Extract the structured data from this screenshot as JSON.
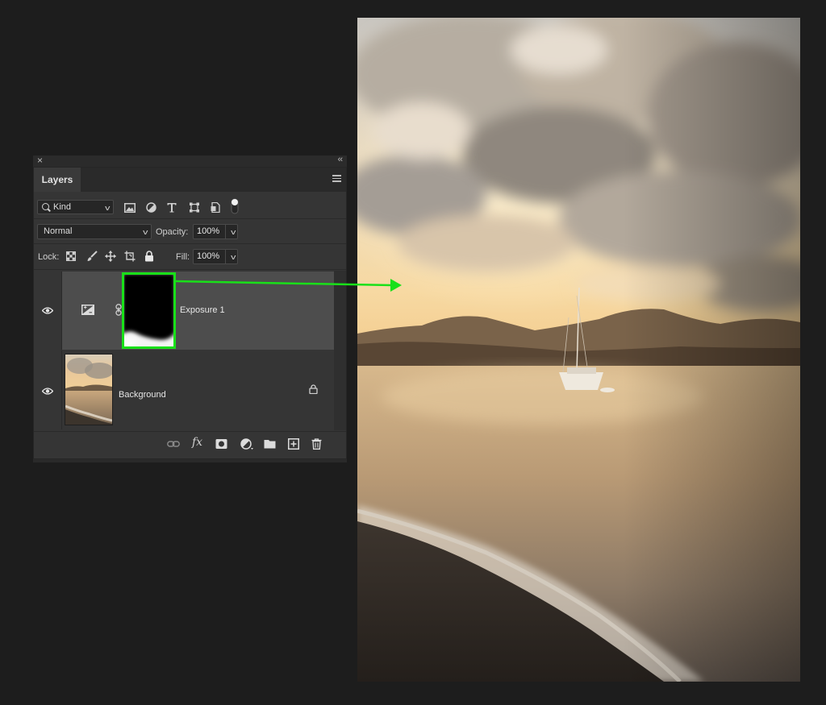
{
  "panel": {
    "close_glyph": "×",
    "collapse_glyph": "‹‹",
    "tab_label": "Layers",
    "filter": {
      "kind_label": "Kind",
      "icons": [
        "image-filter-icon",
        "adjustment-filter-icon",
        "type-filter-icon",
        "shape-filter-icon",
        "smart-object-filter-icon",
        "filter-toggle-icon"
      ]
    },
    "blend_mode": "Normal",
    "opacity_label": "Opacity:",
    "opacity_value": "100%",
    "lock_label": "Lock:",
    "lock_icons": [
      "lock-transparent-icon",
      "lock-image-pixels-icon",
      "lock-position-icon",
      "lock-artboard-icon",
      "lock-all-icon"
    ],
    "fill_label": "Fill:",
    "fill_value": "100%"
  },
  "layers": [
    {
      "name": "Exposure 1",
      "type": "adjustment",
      "visible": true,
      "selected": true,
      "mask_highlighted": true
    },
    {
      "name": "Background",
      "type": "pixel",
      "visible": true,
      "locked": true
    }
  ],
  "footer_icons": [
    "link-layers-icon",
    "fx-icon",
    "add-mask-icon",
    "new-fill-adjustment-icon",
    "new-group-icon",
    "new-layer-icon",
    "delete-layer-icon"
  ],
  "footer": {
    "fx_label": "fx"
  },
  "colors": {
    "highlight": "#19e019",
    "panel_bg": "#353535",
    "selected_layer": "#4d4d4d",
    "app_bg": "#1d1d1d"
  }
}
